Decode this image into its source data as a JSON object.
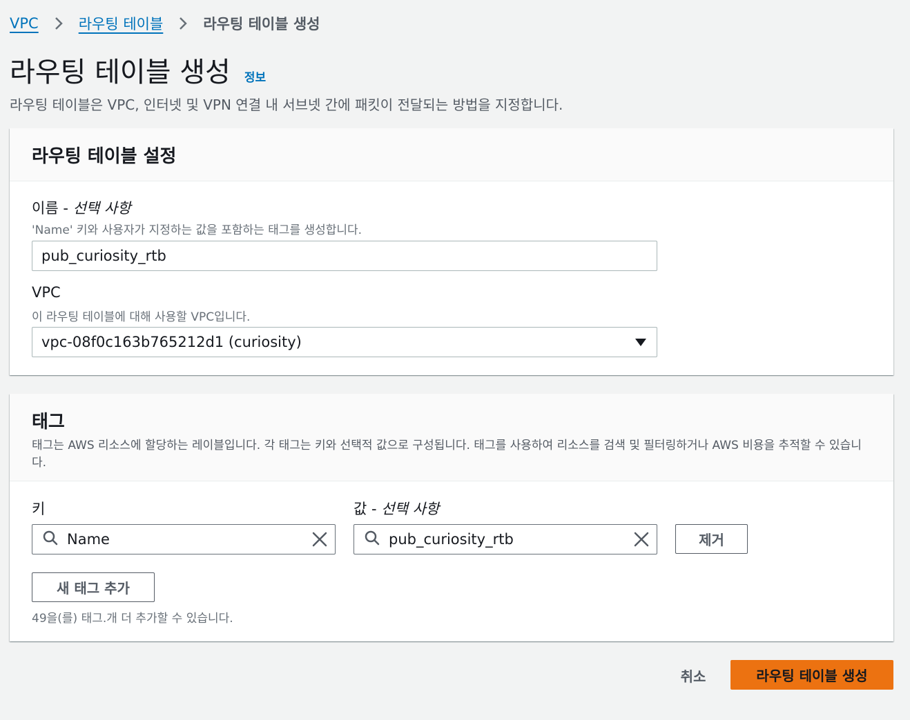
{
  "breadcrumb": {
    "items": [
      {
        "label": "VPC"
      },
      {
        "label": "라우팅 테이블"
      },
      {
        "label": "라우팅 테이블 생성"
      }
    ]
  },
  "header": {
    "title": "라우팅 테이블 생성",
    "info_link": "정보",
    "description": "라우팅 테이블은 VPC, 인터넷 및 VPN 연결 내 서브넷 간에 패킷이 전달되는 방법을 지정합니다."
  },
  "settings": {
    "title": "라우팅 테이블 설정",
    "name_label": "이름 - ",
    "name_optional": "선택 사항",
    "name_desc": "'Name' 키와 사용자가 지정하는 값을 포함하는 태그를 생성합니다.",
    "name_value": "pub_curiosity_rtb",
    "vpc_label": "VPC",
    "vpc_desc": "이 라우팅 테이블에 대해 사용할 VPC입니다.",
    "vpc_value": "vpc-08f0c163b765212d1 (curiosity)"
  },
  "tags": {
    "title": "태그",
    "description": "태그는 AWS 리소스에 할당하는 레이블입니다. 각 태그는 키와 선택적 값으로 구성됩니다. 태그를 사용하여 리소스를 검색 및 필터링하거나 AWS 비용을 추적할 수 있습니다.",
    "key_label": "키",
    "value_label": "값 - ",
    "value_optional": "선택 사항",
    "rows": [
      {
        "key": "Name",
        "value": "pub_curiosity_rtb"
      }
    ],
    "remove_label": "제거",
    "add_label": "새 태그 추가",
    "hint": "49을(를) 태그.개 더 추가할 수 있습니다."
  },
  "footer": {
    "cancel_label": "취소",
    "create_label": "라우팅 테이블 생성"
  },
  "colors": {
    "link": "#0073bb",
    "primary": "#ec7211",
    "background": "#f2f3f3"
  }
}
